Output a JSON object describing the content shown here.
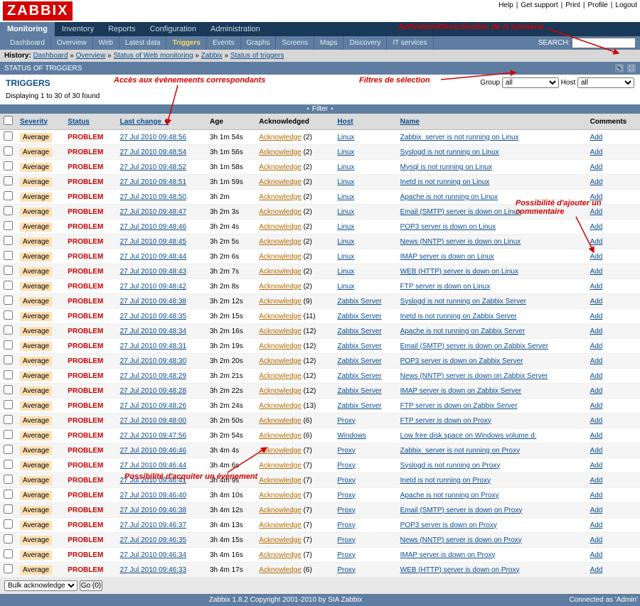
{
  "app": {
    "logo": "ZABBIX"
  },
  "toplinks": [
    "Help",
    "Get support",
    "Print",
    "Profile",
    "Logout"
  ],
  "menu": {
    "tabs": [
      "Monitoring",
      "Inventory",
      "Reports",
      "Configuration",
      "Administration"
    ],
    "active": 0
  },
  "submenu": {
    "tabs": [
      "Dashboard",
      "Overview",
      "Web",
      "Latest data",
      "Triggers",
      "Events",
      "Graphs",
      "Screens",
      "Maps",
      "Discovery",
      "IT services"
    ],
    "active": 4,
    "search_label": "SEARCH:",
    "search_value": ""
  },
  "history": {
    "label": "History:",
    "items": [
      "Dashboard",
      "Overview",
      "Status of Web monitoring",
      "Zabbix",
      "Status of triggers"
    ]
  },
  "section": {
    "title": "STATUS OF TRIGGERS",
    "sound_icon": "🔊",
    "fullscreen_icon": "⛶"
  },
  "page": {
    "heading": "TRIGGERS",
    "count_text": "Displaying 1 to 30 of 30 found",
    "group_label": "Group",
    "group_value": "all",
    "host_label": "Host",
    "host_value": "all",
    "filter_toggle": "⋆  Filter  ⋆"
  },
  "columns": {
    "chk": "",
    "severity": "Severity",
    "status": "Status",
    "last_change": "Last change",
    "age": "Age",
    "ack": "Acknowledged",
    "host": "Host",
    "name": "Name",
    "comments": "Comments"
  },
  "common": {
    "severity": "Average",
    "status": "PROBLEM",
    "ack_label": "Acknowledge",
    "add_label": "Add"
  },
  "rows": [
    {
      "lc": "27 Jul 2010 09:48:56",
      "age": "3h 1m 54s",
      "ackn": 2,
      "host": "Linux",
      "name": "Zabbix_server is not running on Linux"
    },
    {
      "lc": "27 Jul 2010 09:48:54",
      "age": "3h 1m 56s",
      "ackn": 2,
      "host": "Linux",
      "name": "Syslogd is not running on Linux"
    },
    {
      "lc": "27 Jul 2010 09:48:52",
      "age": "3h 1m 58s",
      "ackn": 2,
      "host": "Linux",
      "name": "Mysql is not running on Linux"
    },
    {
      "lc": "27 Jul 2010 09:48:51",
      "age": "3h 1m 59s",
      "ackn": 2,
      "host": "Linux",
      "name": "Inetd is not running on Linux"
    },
    {
      "lc": "27 Jul 2010 09:48:50",
      "age": "3h 2m",
      "ackn": 2,
      "host": "Linux",
      "name": "Apache is not running on Linux"
    },
    {
      "lc": "27 Jul 2010 09:48:47",
      "age": "3h 2m 3s",
      "ackn": 2,
      "host": "Linux",
      "name": "Email (SMTP) server is down on Linux"
    },
    {
      "lc": "27 Jul 2010 09:48:46",
      "age": "3h 2m 4s",
      "ackn": 2,
      "host": "Linux",
      "name": "POP3 server is down on Linux"
    },
    {
      "lc": "27 Jul 2010 09:48:45",
      "age": "3h 2m 5s",
      "ackn": 2,
      "host": "Linux",
      "name": "News (NNTP) server is down on Linux"
    },
    {
      "lc": "27 Jul 2010 09:48:44",
      "age": "3h 2m 6s",
      "ackn": 2,
      "host": "Linux",
      "name": "IMAP server is down on Linux"
    },
    {
      "lc": "27 Jul 2010 09:48:43",
      "age": "3h 2m 7s",
      "ackn": 2,
      "host": "Linux",
      "name": "WEB (HTTP) server is down on Linux"
    },
    {
      "lc": "27 Jul 2010 09:48:42",
      "age": "3h 2m 8s",
      "ackn": 2,
      "host": "Linux",
      "name": "FTP server is down on Linux"
    },
    {
      "lc": "27 Jul 2010 09:48:38",
      "age": "3h 2m 12s",
      "ackn": 9,
      "host": "Zabbix Server",
      "name": "Syslogd is not running on Zabbix Server"
    },
    {
      "lc": "27 Jul 2010 09:48:35",
      "age": "3h 2m 15s",
      "ackn": 11,
      "host": "Zabbix Server",
      "name": "Inetd is not running on Zabbix Server"
    },
    {
      "lc": "27 Jul 2010 09:48:34",
      "age": "3h 2m 16s",
      "ackn": 12,
      "host": "Zabbix Server",
      "name": "Apache is not running on Zabbix Server"
    },
    {
      "lc": "27 Jul 2010 09:48:31",
      "age": "3h 2m 19s",
      "ackn": 12,
      "host": "Zabbix Server",
      "name": "Email (SMTP) server is down on Zabbix Server"
    },
    {
      "lc": "27 Jul 2010 09:48:30",
      "age": "3h 2m 20s",
      "ackn": 12,
      "host": "Zabbix Server",
      "name": "POP3 server is down on Zabbix Server"
    },
    {
      "lc": "27 Jul 2010 09:48:29",
      "age": "3h 2m 21s",
      "ackn": 12,
      "host": "Zabbix Server",
      "name": "News (NNTP) server is down on Zabbix Server"
    },
    {
      "lc": "27 Jul 2010 09:48:28",
      "age": "3h 2m 22s",
      "ackn": 12,
      "host": "Zabbix Server",
      "name": "IMAP server is down on Zabbix Server"
    },
    {
      "lc": "27 Jul 2010 09:48:26",
      "age": "3h 2m 24s",
      "ackn": 13,
      "host": "Zabbix Server",
      "name": "FTP server is down on Zabbix Server"
    },
    {
      "lc": "27 Jul 2010 09:48:00",
      "age": "3h 2m 50s",
      "ackn": 6,
      "host": "Proxy",
      "name": "FTP server is down on Proxy"
    },
    {
      "lc": "27 Jul 2010 09:47:56",
      "age": "3h 2m 54s",
      "ackn": 6,
      "host": "Windows",
      "name": "Low free disk space on Windows volume d:"
    },
    {
      "lc": "27 Jul 2010 09:46:46",
      "age": "3h 4m 4s",
      "ackn": 7,
      "host": "Proxy",
      "name": "Zabbix_server is not running on Proxy"
    },
    {
      "lc": "27 Jul 2010 09:46:44",
      "age": "3h 4m 6s",
      "ackn": 7,
      "host": "Proxy",
      "name": "Syslogd is not running on Proxy"
    },
    {
      "lc": "27 Jul 2010 09:46:41",
      "age": "3h 4m 9s",
      "ackn": 7,
      "host": "Proxy",
      "name": "Inetd is not running on Proxy"
    },
    {
      "lc": "27 Jul 2010 09:46:40",
      "age": "3h 4m 10s",
      "ackn": 7,
      "host": "Proxy",
      "name": "Apache is not running on Proxy"
    },
    {
      "lc": "27 Jul 2010 09:46:38",
      "age": "3h 4m 12s",
      "ackn": 7,
      "host": "Proxy",
      "name": "Email (SMTP) server is down on Proxy"
    },
    {
      "lc": "27 Jul 2010 09:46:37",
      "age": "3h 4m 13s",
      "ackn": 7,
      "host": "Proxy",
      "name": "POP3 server is down on Proxy"
    },
    {
      "lc": "27 Jul 2010 09:46:35",
      "age": "3h 4m 15s",
      "ackn": 7,
      "host": "Proxy",
      "name": "News (NNTP) server is down on Proxy"
    },
    {
      "lc": "27 Jul 2010 09:46:34",
      "age": "3h 4m 16s",
      "ackn": 7,
      "host": "Proxy",
      "name": "IMAP server is down on Proxy"
    },
    {
      "lc": "27 Jul 2010 09:46:33",
      "age": "3h 4m 17s",
      "ackn": 6,
      "host": "Proxy",
      "name": "WEB (HTTP) server is down on Proxy"
    }
  ],
  "bulk": {
    "select_value": "Bulk acknowledge",
    "go_label": "Go (0)"
  },
  "footer": {
    "copyright": "Zabbix 1.8.2 Copyright 2001-2010 by SIA Zabbix",
    "user": "Connected as 'Admin'"
  },
  "annotations": {
    "a1": "Activation/Désactivation de la sonnerie",
    "a2": "Filtres de sélection",
    "a3": "Accès aux évènemeents correspondants",
    "a4": "Possibilité d'ajouter un commentaire",
    "a5": "Possibilité d'acquiter un évènement"
  }
}
